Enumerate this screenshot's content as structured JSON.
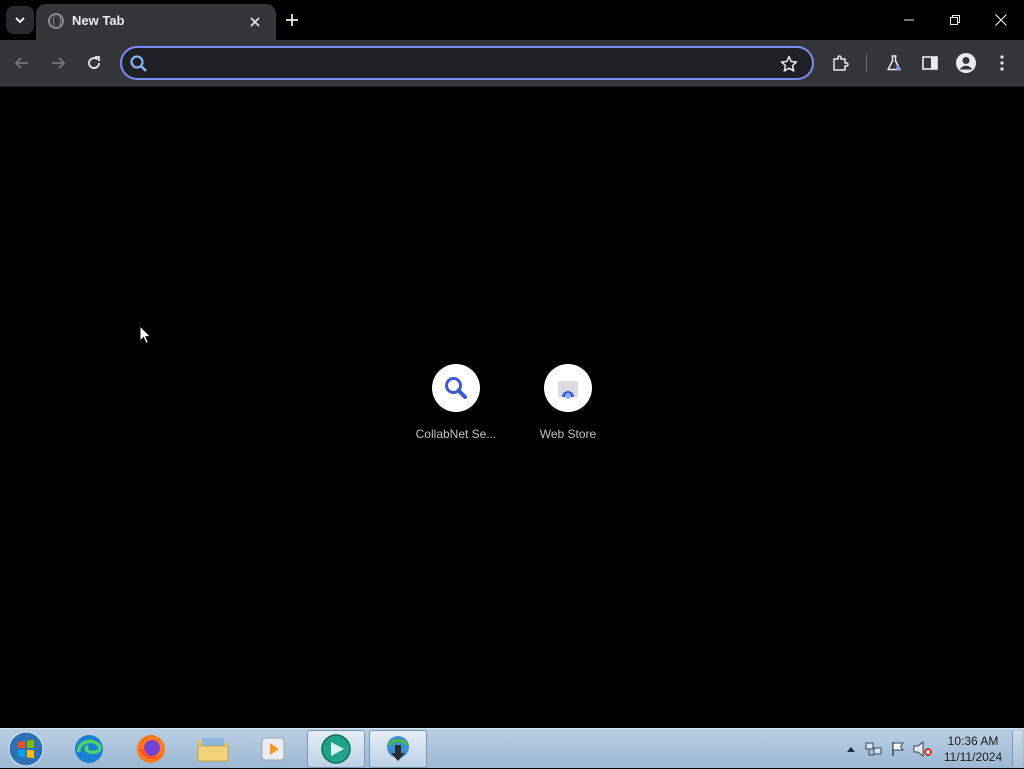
{
  "browser": {
    "tab": {
      "title": "New Tab"
    },
    "omnibox": {
      "value": "",
      "placeholder": ""
    }
  },
  "shortcuts": [
    {
      "label": "CollabNet Se..."
    },
    {
      "label": "Web Store"
    }
  ],
  "taskbar": {
    "clock": {
      "time": "10:36 AM",
      "date": "11/11/2024"
    }
  },
  "colors": {
    "accent": "#7b8ef8",
    "toolbar": "#35363a",
    "page_background": "#000000",
    "shortcut_icon": "#3b5bd6"
  }
}
